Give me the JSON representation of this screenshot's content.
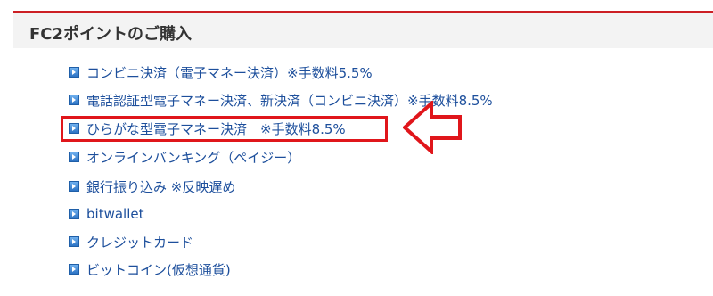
{
  "header": {
    "title": "FC2ポイントのご購入"
  },
  "payment_methods": [
    {
      "label": "コンビニ決済（電子マネー決済）※手数料5.5%"
    },
    {
      "label": "電話認証型電子マネー決済、新決済（コンビニ決済）※手数料8.5%"
    },
    {
      "label": "ひらがな型電子マネー決済　※手数料8.5%"
    },
    {
      "label": "オンラインバンキング（ペイジー）"
    },
    {
      "label": "銀行振り込み ※反映遅め"
    },
    {
      "label": "bitwallet"
    },
    {
      "label": "クレジットカード"
    },
    {
      "label": "ビットコイン(仮想通貨)"
    }
  ],
  "highlight": {
    "target_item_index": 2,
    "color": "#e0161b"
  },
  "colors": {
    "accent": "#cc1f24",
    "link": "#1d4f9c",
    "header_bg": "#f3f3f3",
    "icon": "#2c73c4"
  },
  "icons": {
    "list_item": "square-arrow-icon",
    "annotation": "left-arrow-icon"
  }
}
